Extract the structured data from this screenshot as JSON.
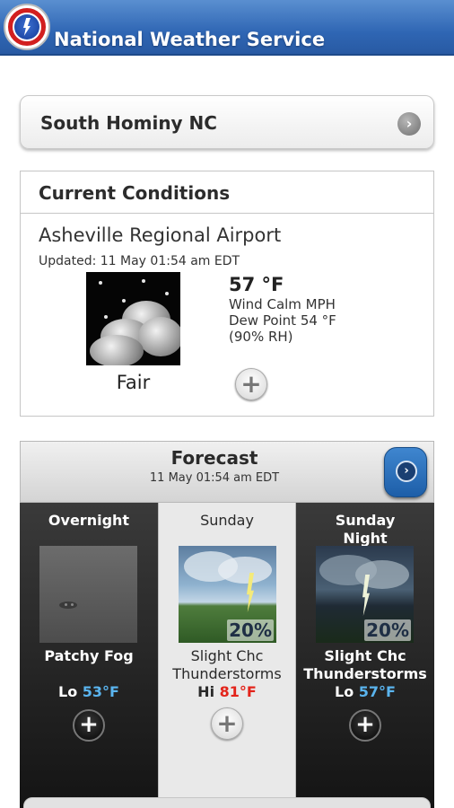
{
  "app": {
    "title": "National Weather Service",
    "logo_icon": "nws-logo-icon"
  },
  "location": {
    "name": "South Hominy NC",
    "chevron_icon": "chevron-right-icon"
  },
  "current_conditions": {
    "header": "Current Conditions",
    "station": "Asheville Regional Airport",
    "updated": "Updated: 11 May 01:54 am EDT",
    "condition": "Fair",
    "temperature": "57 °F",
    "wind": "Wind Calm MPH",
    "dew_point": "Dew Point 54 °F",
    "humidity": "(90% RH)",
    "more_icon": "plus-icon"
  },
  "forecast": {
    "header": "Forecast",
    "date": "11 May 01:54 am EDT",
    "next_icon": "chevron-right-icon",
    "periods": [
      {
        "name": "Overnight",
        "description": "Patchy Fog",
        "temp_label": "Lo",
        "temp": "53°F",
        "precip": ""
      },
      {
        "name": "Sunday",
        "description_1": "Slight Chc",
        "description_2": "Thunderstorms",
        "temp_label": "Hi",
        "temp": "81°F",
        "precip": "20%"
      },
      {
        "name_1": "Sunday",
        "name_2": "Night",
        "description_1": "Slight Chc",
        "description_2": "Thunderstorms",
        "temp_label": "Lo",
        "temp": "57°F",
        "precip": "20%"
      }
    ]
  },
  "colors": {
    "appbar": "#2f66b4",
    "lo_temp": "#5ab4ee",
    "hi_temp": "#e3241b"
  }
}
